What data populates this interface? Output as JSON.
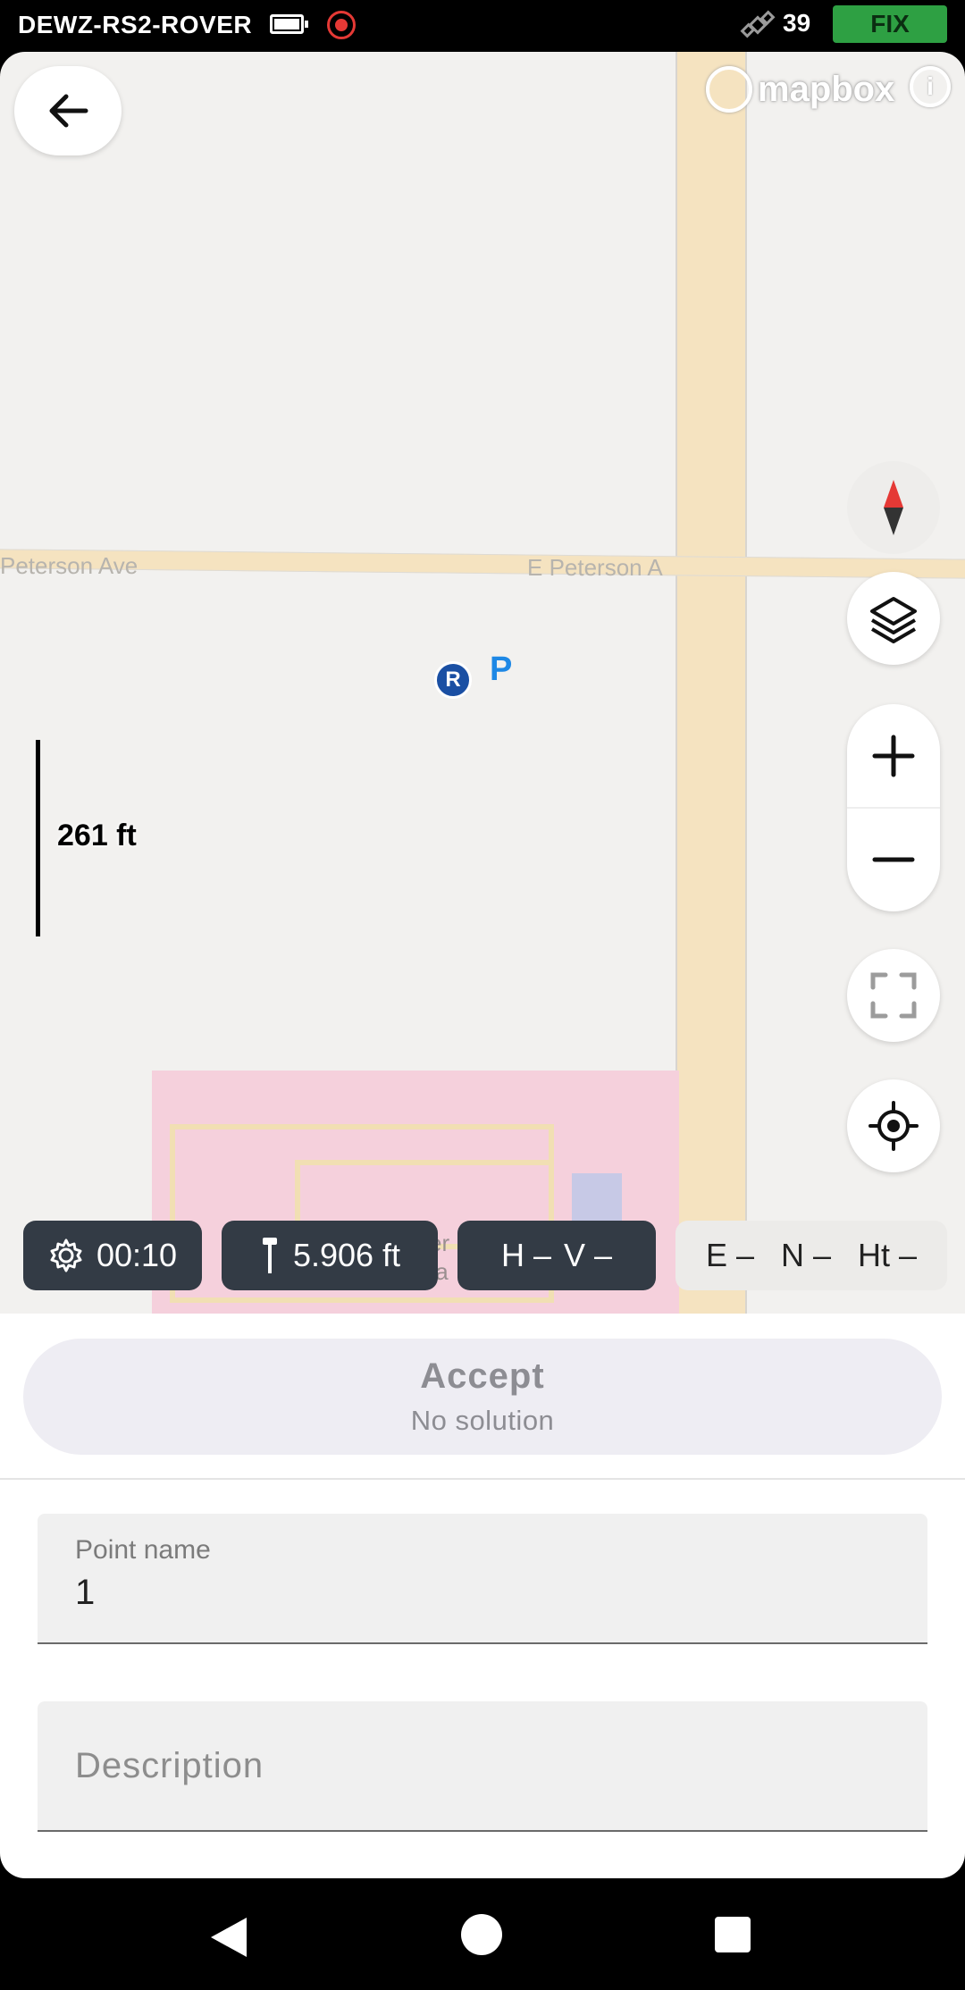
{
  "status_bar": {
    "device_name": "DEWZ-RS2-ROVER",
    "satellite_count": "39",
    "fix_status": "FIX",
    "fix_color": "#2ea043",
    "icons": [
      "battery-icon",
      "recording-icon",
      "satellite-icon"
    ]
  },
  "map": {
    "attribution": "mapbox",
    "info_icon_text": "i",
    "street_labels": [
      "Peterson Ave",
      "E Peterson A"
    ],
    "campus_labels": [
      "er",
      "ta"
    ],
    "scale_label": "261 ft",
    "rover_marker": "R",
    "point_marker": "P",
    "controls": [
      "back-arrow-icon",
      "compass-icon",
      "layers-icon",
      "zoom-in-icon",
      "zoom-out-icon",
      "fullscreen-icon",
      "locate-icon"
    ]
  },
  "info_chips": {
    "timer": "00:10",
    "antenna_height": "5.906 ft",
    "h_label": "H –",
    "v_label": "V –",
    "e_label": "E –",
    "n_label": "N –",
    "ht_label": "Ht –"
  },
  "sheet": {
    "accept_label": "Accept",
    "accept_status": "No solution",
    "point_name_label": "Point name",
    "point_name_value": "1",
    "description_placeholder": "Description"
  }
}
